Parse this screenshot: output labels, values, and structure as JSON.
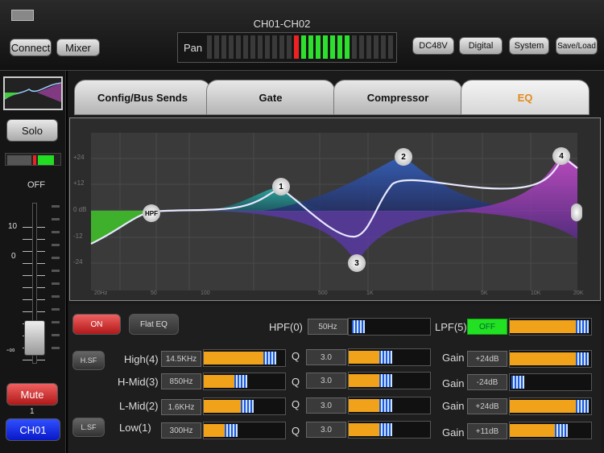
{
  "header": {
    "title": "CH01-CH02",
    "connect": "Connect",
    "mixer": "Mixer",
    "dc48v": "DC48V",
    "digital": "Digital",
    "system": "System",
    "saveload": "Save/Load",
    "pan_label": "Pan"
  },
  "sidebar": {
    "solo": "Solo",
    "fader_label": "OFF",
    "scale": [
      "10",
      "0",
      "-∞"
    ],
    "mute": "Mute",
    "channel_number": "1",
    "channel": "CH01"
  },
  "tabs": [
    {
      "label": "Config/Bus Sends"
    },
    {
      "label": "Gate"
    },
    {
      "label": "Compressor"
    },
    {
      "label": "EQ",
      "active": true
    }
  ],
  "graph": {
    "y_ticks": [
      "+24",
      "+12",
      "0 dB",
      "-12",
      "-24"
    ],
    "x_ticks": [
      "20Hz",
      "50",
      "100",
      "500",
      "1K",
      "5K",
      "10K",
      "20K"
    ],
    "nodes": [
      "HPF",
      "1",
      "2",
      "3",
      "4"
    ]
  },
  "controls": {
    "on": "ON",
    "flat_eq": "Flat EQ",
    "hsf": "H.SF",
    "lsf": "L.SF",
    "hpf_label": "HPF(0)",
    "hpf_value": "50Hz",
    "lpf_label": "LPF(5)",
    "lpf_value": "OFF",
    "bands": [
      {
        "label": "High(4)",
        "freq": "14.5KHz",
        "q": "3.0",
        "gain_label": "Gain",
        "gain": "+24dB"
      },
      {
        "label": "H-Mid(3)",
        "freq": "850Hz",
        "q": "3.0",
        "gain_label": "Gain",
        "gain": "-24dB"
      },
      {
        "label": "L-Mid(2)",
        "freq": "1.6KHz",
        "q": "3.0",
        "gain_label": "Gain",
        "gain": "+24dB"
      },
      {
        "label": "Low(1)",
        "freq": "300Hz",
        "q": "3.0",
        "gain_label": "Gain",
        "gain": "+11dB"
      }
    ],
    "q_label": "Q"
  },
  "colors": {
    "accent": "#f0a21a",
    "active_tab_text": "#e38a1a",
    "lpf_off": "#22e022",
    "channel_blue": "#1030e0"
  }
}
